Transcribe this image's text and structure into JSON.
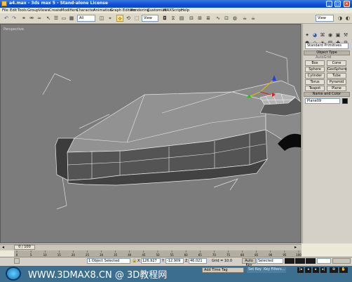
{
  "window": {
    "title": "a4.max - 3ds max 5 - Stand-alone License"
  },
  "titlebar_buttons": {
    "minimize": "_",
    "maximize": "□",
    "close": "×"
  },
  "menu": [
    "File",
    "Edit",
    "Tools",
    "Group",
    "Views",
    "Create",
    "Modifiers",
    "Character",
    "Animation",
    "Graph Editors",
    "Rendering",
    "Customize",
    "MAXScript",
    "Help"
  ],
  "toolbar": {
    "selection_filter": "All",
    "ref_coord": "View",
    "view_dropdown": "View",
    "icons": [
      "undo-icon",
      "redo-icon",
      "link-icon",
      "unlink-icon",
      "bind-icon",
      "select-icon",
      "select-by-name-icon",
      "rect-region-icon",
      "filter-icon",
      "move-icon",
      "rotate-icon",
      "scale-icon",
      "pivot-icon",
      "mirror-icon",
      "align-icon",
      "layer-icon",
      "curve-editor-icon",
      "schematic-icon",
      "material-editor-icon",
      "render-scene-icon",
      "quick-render-icon"
    ]
  },
  "viewport": {
    "label": "Perspective"
  },
  "command_panel": {
    "tabs": [
      "create-tab-icon",
      "modify-tab-icon",
      "hierarchy-tab-icon",
      "motion-tab-icon",
      "display-tab-icon",
      "utilities-tab-icon"
    ],
    "category": "Standard Primitives",
    "rollout_object_type": "Object Type",
    "autogrid_label": "AutoGrid",
    "primitives": [
      "Box",
      "Cone",
      "Sphere",
      "GeoSphere",
      "Cylinder",
      "Tube",
      "Torus",
      "Pyramid",
      "Teapot",
      "Plane"
    ],
    "rollout_name_color": "Name and Color",
    "object_name": "Plane09",
    "object_color": "#0b0b0b"
  },
  "timeline": {
    "frame_display": "0 / 100",
    "ticks": [
      "0",
      "5",
      "10",
      "15",
      "20",
      "25",
      "30",
      "35",
      "40",
      "45",
      "50",
      "55",
      "60",
      "65",
      "70",
      "75",
      "80",
      "85",
      "90",
      "95",
      "100"
    ]
  },
  "status": {
    "selection": "1 Object Selected",
    "x_label": "X",
    "x": "126.927",
    "y_label": "Y",
    "y": "-12.909",
    "z_label": "Z",
    "z": "46.021",
    "grid": "Grid = 10.0",
    "autokey": "Auto Key",
    "selected_dropdown": "Selected",
    "set_key": "Set Key",
    "key_filters": "Key Filters...",
    "add_time_tag": "Add Time Tag"
  },
  "watermark": {
    "text": "WWW.3DMAX8.CN @ 3D教程网"
  },
  "colors": {
    "viewport_bg": "#7c7c7c",
    "panel_bg": "#d4d0c8",
    "titlebar": "#0a4fd6",
    "bottombar": "#3c6e8f"
  }
}
